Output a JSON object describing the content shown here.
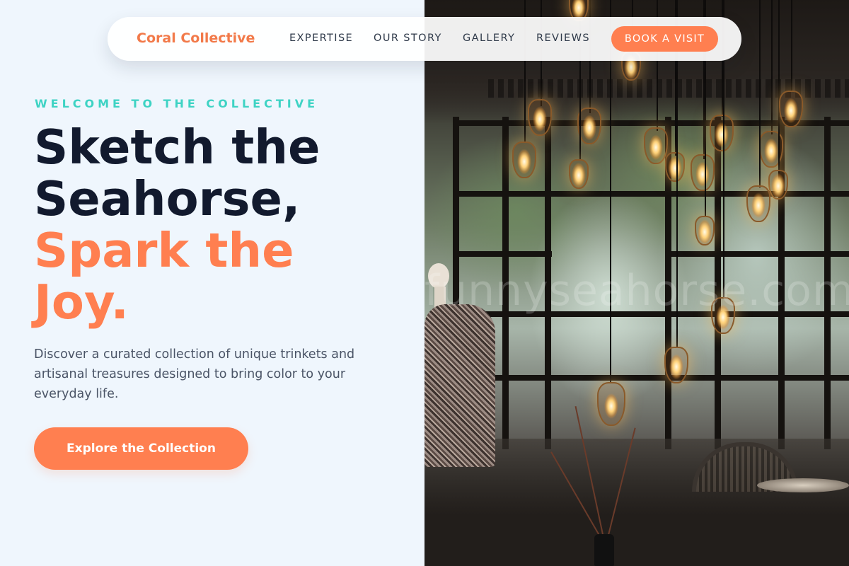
{
  "nav": {
    "brand": "Coral Collective",
    "links": [
      {
        "label": "EXPERTISE"
      },
      {
        "label": "OUR STORY"
      },
      {
        "label": "GALLERY"
      },
      {
        "label": "REVIEWS"
      }
    ],
    "cta_label": "BOOK A VISIT"
  },
  "hero": {
    "eyebrow": "WELCOME TO THE COLLECTIVE",
    "headline_line1": "Sketch the",
    "headline_line2": "Seahorse,",
    "headline_accent_line1": "Spark the",
    "headline_accent_line2": "Joy.",
    "description": "Discover a curated collection of unique trinkets and artisanal treasures designed to bring color to your everyday life.",
    "button_label": "Explore the Collection"
  },
  "image": {
    "watermark": "funnyseahorse.com"
  },
  "colors": {
    "accent": "#ff7f50",
    "teal": "#3ed3c4",
    "navy": "#121a2e",
    "background": "#eff6fd"
  }
}
